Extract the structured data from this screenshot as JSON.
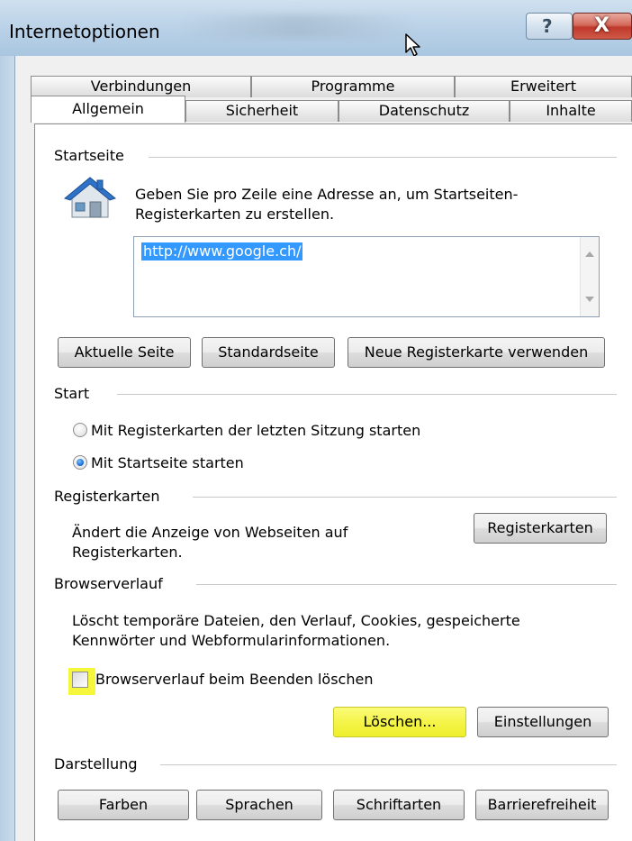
{
  "window": {
    "title": "Internetoptionen",
    "help_glyph": "?",
    "close_glyph": "X"
  },
  "tabs": {
    "row_back": [
      "Verbindungen",
      "Programme",
      "Erweitert"
    ],
    "row_front": [
      "Allgemein",
      "Sicherheit",
      "Datenschutz",
      "Inhalte"
    ],
    "active": "Allgemein"
  },
  "startseite": {
    "label": "Startseite",
    "description_line1": "Geben Sie pro Zeile eine Adresse an, um Startseiten-",
    "description_line2": "Registerkarten zu erstellen.",
    "url_value": "http://www.google.ch/",
    "btn_current": "Aktuelle Seite",
    "btn_default": "Standardseite",
    "btn_new_tab": "Neue Registerkarte verwenden"
  },
  "start": {
    "label": "Start",
    "option_last_session": "Mit Registerkarten der letzten Sitzung starten",
    "option_homepage": "Mit Startseite starten",
    "selected": "option_homepage"
  },
  "registerkarten": {
    "label": "Registerkarten",
    "description_line1": "Ändert die Anzeige von Webseiten auf",
    "description_line2": "Registerkarten.",
    "button": "Registerkarten"
  },
  "browserverlauf": {
    "label": "Browserverlauf",
    "description_line1": "Löscht temporäre Dateien, den Verlauf, Cookies, gespeicherte",
    "description_line2": "Kennwörter und Webformularinformationen.",
    "checkbox_label": "Browserverlauf beim Beenden löschen",
    "checkbox_checked": false,
    "btn_delete": "Löschen...",
    "btn_settings": "Einstellungen",
    "highlight_color": "#f6f63a"
  },
  "darstellung": {
    "label": "Darstellung",
    "btn_colors": "Farben",
    "btn_languages": "Sprachen",
    "btn_fonts": "Schriftarten",
    "btn_accessibility": "Barrierefreiheit"
  }
}
